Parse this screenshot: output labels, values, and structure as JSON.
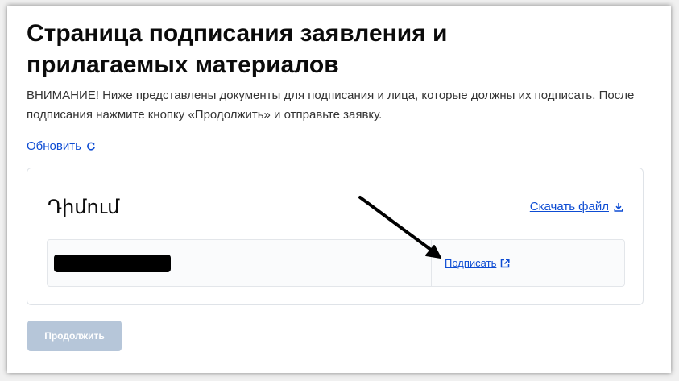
{
  "page": {
    "title": "Страница подписания заявления и прилагаемых материалов",
    "notice": "ВНИМАНИЕ! Ниже представлены документы для подписания и лица, которые должны их подписать. После подписания нажмите кнопку «Продолжить» и отправьте заявку.",
    "refresh_label": "Обновить",
    "refresh_icon": "refresh-icon"
  },
  "document": {
    "title": "Դիմում",
    "download_label": "Скачать файл",
    "download_icon": "download-icon",
    "signers": [
      {
        "name_redacted": true,
        "sign_label": "Подписать",
        "sign_icon": "external-link-icon"
      }
    ]
  },
  "footer": {
    "continue_label": "Продолжить",
    "continue_disabled": true
  },
  "colors": {
    "link": "#0d4cd3",
    "disabled_button": "#b6c6d9",
    "border": "#dfe3e8"
  }
}
